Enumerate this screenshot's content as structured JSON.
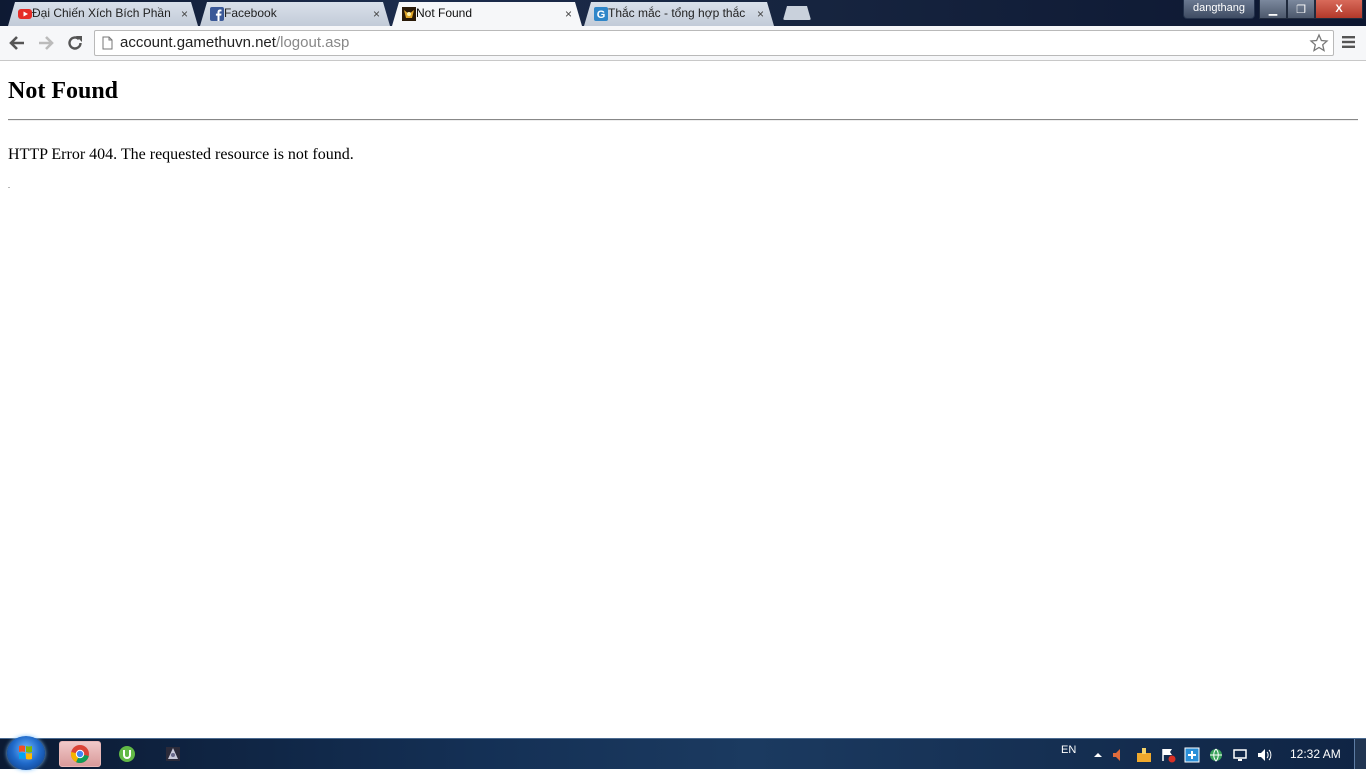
{
  "browser": {
    "tabs": [
      {
        "label": "Đại Chiến Xích Bích Phần",
        "favicon": "youtube-icon",
        "active": false
      },
      {
        "label": "Facebook",
        "favicon": "facebook-icon",
        "active": false
      },
      {
        "label": "Not Found",
        "favicon": "site-icon",
        "active": true
      },
      {
        "label": "Thắc mắc - tổng hợp thắc",
        "favicon": "g-site-icon",
        "active": false
      }
    ],
    "tab_close_glyph": "×",
    "user": "dangthang",
    "window_buttons": {
      "minimize": "▁",
      "maximize": "❐",
      "close": "X"
    },
    "address": {
      "domain": "account.gamethuvn.net",
      "path": "/logout.asp"
    }
  },
  "page": {
    "heading": "Not Found",
    "message": "HTTP Error 404. The requested resource is not found.",
    "trailing": "."
  },
  "taskbar": {
    "language": "EN",
    "clock": "12:32 AM",
    "apps": [
      "chrome-icon",
      "utorrent-icon",
      "game-icon"
    ]
  },
  "colors": {
    "accent": "#1f69c9",
    "tab_active": "#f6f7f9",
    "taskbar": "#143055"
  }
}
